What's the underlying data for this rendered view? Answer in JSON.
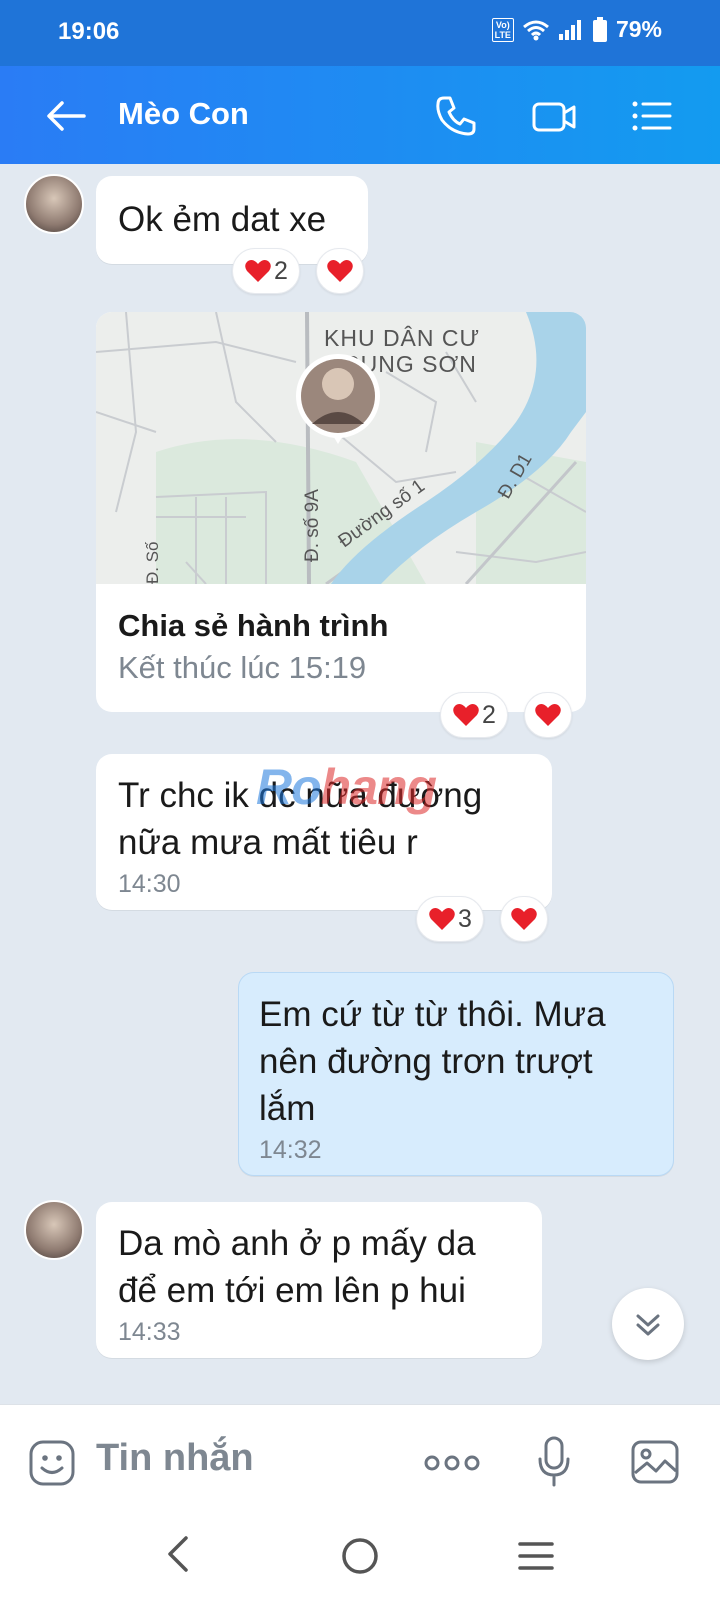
{
  "status_bar": {
    "time": "19:06",
    "network_badge": "VoLTE",
    "battery": "79%"
  },
  "header": {
    "title": "Mèo Con",
    "icons": [
      "back-arrow-icon",
      "phone-icon",
      "video-call-icon",
      "menu-list-icon"
    ]
  },
  "messages": [
    {
      "sender": "other",
      "type": "text",
      "text": "Ok ẻm dat xe",
      "reactions": {
        "count_label": "2"
      }
    },
    {
      "sender": "other",
      "type": "location",
      "map_labels": [
        "KHU DÂN CƯ",
        "TRUNG SƠN",
        "Đ. số 9A",
        "Đường số 1",
        "Đ. D1",
        "Đ. Số"
      ],
      "card_title": "Chia sẻ hành trình",
      "card_subtitle": "Kết thúc lúc 15:19",
      "reactions": {
        "count_label": "2"
      }
    },
    {
      "sender": "other",
      "type": "text",
      "text": "Tr chc ik dc nữa đường nữa mưa mất tiêu r",
      "time": "14:30",
      "reactions": {
        "count_label": "3"
      }
    },
    {
      "sender": "me",
      "type": "text",
      "text": "Em cứ từ từ thôi. Mưa nên đường trơn trượt lắm",
      "time": "14:32"
    },
    {
      "sender": "other",
      "type": "text",
      "text": "Da mò anh ở p mấy da để em tới em lên p hui",
      "time": "14:33"
    }
  ],
  "watermark": {
    "part1": "Ro",
    "part2": "hang"
  },
  "input_bar": {
    "placeholder": "Tin nhắn",
    "icons": [
      "emoji-icon",
      "more-dots-icon",
      "microphone-icon",
      "image-icon"
    ]
  },
  "nav_bar": {
    "icons": [
      "nav-back-icon",
      "nav-home-icon",
      "nav-recents-icon"
    ]
  },
  "colors": {
    "header_start": "#2a7cf5",
    "header_end": "#139bf0",
    "chat_bg": "#e2e9f1",
    "outgoing_bubble": "#d7ecfd",
    "heart": "#e8202a"
  }
}
